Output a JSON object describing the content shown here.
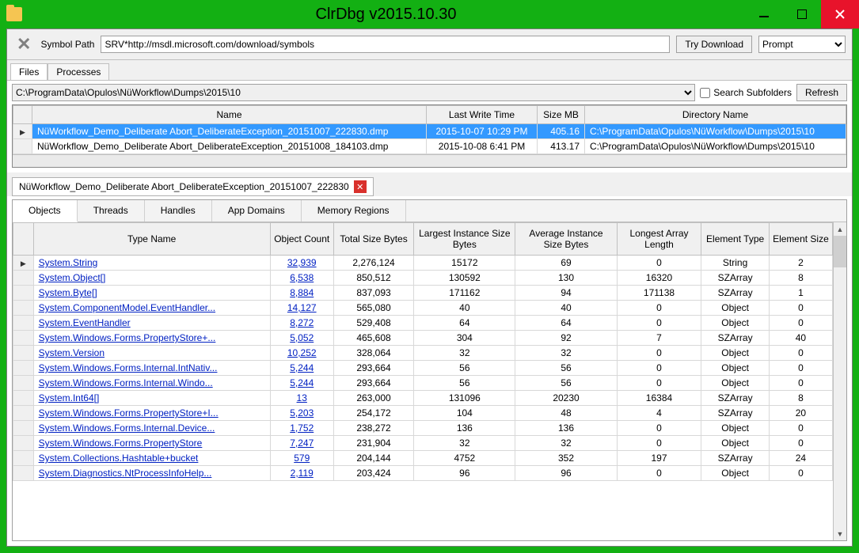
{
  "window": {
    "title": "ClrDbg v2015.10.30"
  },
  "toolbar": {
    "symbol_path_label": "Symbol Path",
    "symbol_path_value": "SRV*http://msdl.microsoft.com/download/symbols",
    "try_download_label": "Try Download",
    "prompt_label": "Prompt"
  },
  "topTabs": {
    "files": "Files",
    "processes": "Processes"
  },
  "path": {
    "value": "C:\\ProgramData\\Opulos\\NüWorkflow\\Dumps\\2015\\10",
    "search_subfolders_label": "Search Subfolders",
    "refresh_label": "Refresh"
  },
  "filesGrid": {
    "headers": {
      "name": "Name",
      "lwt": "Last Write Time",
      "size": "Size MB",
      "dir": "Directory Name"
    },
    "rows": [
      {
        "name": "NüWorkflow_Demo_Deliberate Abort_DeliberateException_20151007_222830.dmp",
        "lwt": "2015-10-07 10:29 PM",
        "size": "405.16",
        "dir": "C:\\ProgramData\\Opulos\\NüWorkflow\\Dumps\\2015\\10"
      },
      {
        "name": "NüWorkflow_Demo_Deliberate Abort_DeliberateException_20151008_184103.dmp",
        "lwt": "2015-10-08 6:41 PM",
        "size": "413.17",
        "dir": "C:\\ProgramData\\Opulos\\NüWorkflow\\Dumps\\2015\\10"
      }
    ]
  },
  "dumpTab": {
    "label": "NüWorkflow_Demo_Deliberate Abort_DeliberateException_20151007_222830"
  },
  "segTabs": {
    "objects": "Objects",
    "threads": "Threads",
    "handles": "Handles",
    "appdomains": "App Domains",
    "memregions": "Memory Regions"
  },
  "objGrid": {
    "headers": {
      "type": "Type Name",
      "count": "Object Count",
      "total": "Total Size Bytes",
      "largest": "Largest Instance Size Bytes",
      "avg": "Average Instance Size Bytes",
      "arrlen": "Longest Array Length",
      "etype": "Element Type",
      "esize": "Element Size"
    },
    "rows": [
      {
        "type": "System.String",
        "count": "32,939",
        "total": "2,276,124",
        "largest": "15172",
        "avg": "69",
        "arrlen": "0",
        "etype": "String",
        "esize": "2"
      },
      {
        "type": "System.Object[]",
        "count": "6,538",
        "total": "850,512",
        "largest": "130592",
        "avg": "130",
        "arrlen": "16320",
        "etype": "SZArray",
        "esize": "8"
      },
      {
        "type": "System.Byte[]",
        "count": "8,884",
        "total": "837,093",
        "largest": "171162",
        "avg": "94",
        "arrlen": "171138",
        "etype": "SZArray",
        "esize": "1"
      },
      {
        "type": "System.ComponentModel.EventHandler...",
        "count": "14,127",
        "total": "565,080",
        "largest": "40",
        "avg": "40",
        "arrlen": "0",
        "etype": "Object",
        "esize": "0"
      },
      {
        "type": "System.EventHandler",
        "count": "8,272",
        "total": "529,408",
        "largest": "64",
        "avg": "64",
        "arrlen": "0",
        "etype": "Object",
        "esize": "0"
      },
      {
        "type": "System.Windows.Forms.PropertyStore+...",
        "count": "5,052",
        "total": "465,608",
        "largest": "304",
        "avg": "92",
        "arrlen": "7",
        "etype": "SZArray",
        "esize": "40"
      },
      {
        "type": "System.Version",
        "count": "10,252",
        "total": "328,064",
        "largest": "32",
        "avg": "32",
        "arrlen": "0",
        "etype": "Object",
        "esize": "0"
      },
      {
        "type": "System.Windows.Forms.Internal.IntNativ...",
        "count": "5,244",
        "total": "293,664",
        "largest": "56",
        "avg": "56",
        "arrlen": "0",
        "etype": "Object",
        "esize": "0"
      },
      {
        "type": "System.Windows.Forms.Internal.Windo...",
        "count": "5,244",
        "total": "293,664",
        "largest": "56",
        "avg": "56",
        "arrlen": "0",
        "etype": "Object",
        "esize": "0"
      },
      {
        "type": "System.Int64[]",
        "count": "13",
        "total": "263,000",
        "largest": "131096",
        "avg": "20230",
        "arrlen": "16384",
        "etype": "SZArray",
        "esize": "8"
      },
      {
        "type": "System.Windows.Forms.PropertyStore+I...",
        "count": "5,203",
        "total": "254,172",
        "largest": "104",
        "avg": "48",
        "arrlen": "4",
        "etype": "SZArray",
        "esize": "20"
      },
      {
        "type": "System.Windows.Forms.Internal.Device...",
        "count": "1,752",
        "total": "238,272",
        "largest": "136",
        "avg": "136",
        "arrlen": "0",
        "etype": "Object",
        "esize": "0"
      },
      {
        "type": "System.Windows.Forms.PropertyStore",
        "count": "7,247",
        "total": "231,904",
        "largest": "32",
        "avg": "32",
        "arrlen": "0",
        "etype": "Object",
        "esize": "0"
      },
      {
        "type": "System.Collections.Hashtable+bucket",
        "count": "579",
        "total": "204,144",
        "largest": "4752",
        "avg": "352",
        "arrlen": "197",
        "etype": "SZArray",
        "esize": "24"
      },
      {
        "type": "System.Diagnostics.NtProcessInfoHelp...",
        "count": "2,119",
        "total": "203,424",
        "largest": "96",
        "avg": "96",
        "arrlen": "0",
        "etype": "Object",
        "esize": "0"
      }
    ]
  }
}
